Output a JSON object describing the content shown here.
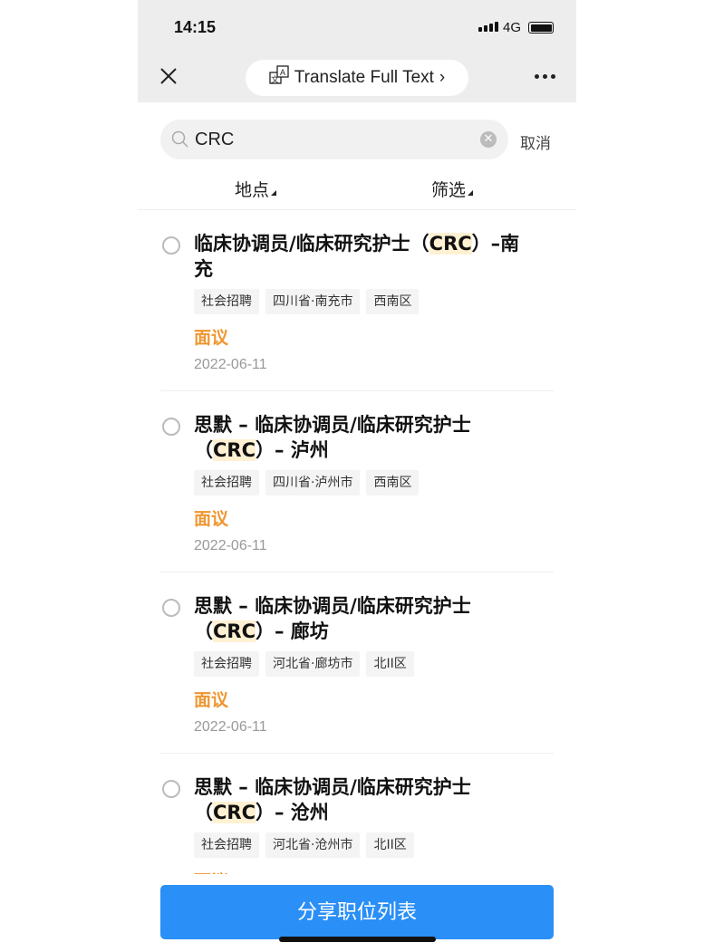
{
  "status": {
    "time": "14:15",
    "network": "4G"
  },
  "nav": {
    "translate_label": "Translate Full Text",
    "translate_chevron": "›"
  },
  "search": {
    "value": "CRC",
    "cancel_label": "取消"
  },
  "filters": [
    {
      "label": "地点"
    },
    {
      "label": "筛选"
    }
  ],
  "jobs": [
    {
      "title_pre": "临床协调员/临床研究护士（",
      "title_hl": "CRC",
      "title_post": "）–南充",
      "tags": [
        "社会招聘",
        "四川省·南充市",
        "西南区"
      ],
      "salary": "面议",
      "date": "2022-06-11"
    },
    {
      "title_pre": "思默 – 临床协调员/临床研究护士（",
      "title_hl": "CRC",
      "title_post": "）– 泸州",
      "tags": [
        "社会招聘",
        "四川省·泸州市",
        "西南区"
      ],
      "salary": "面议",
      "date": "2022-06-11"
    },
    {
      "title_pre": "思默 – 临床协调员/临床研究护士（",
      "title_hl": "CRC",
      "title_post": "）– 廊坊",
      "tags": [
        "社会招聘",
        "河北省·廊坊市",
        "北II区"
      ],
      "salary": "面议",
      "date": "2022-06-11"
    },
    {
      "title_pre": "思默 – 临床协调员/临床研究护士（",
      "title_hl": "CRC",
      "title_post": "）– 沧州",
      "tags": [
        "社会招聘",
        "河北省·沧州市",
        "北II区"
      ],
      "salary": "面议",
      "date": ""
    }
  ],
  "share_button": "分享职位列表",
  "colors": {
    "accent": "#2a8ff6",
    "salary": "#f0952e",
    "highlight": "#fff1d2"
  }
}
